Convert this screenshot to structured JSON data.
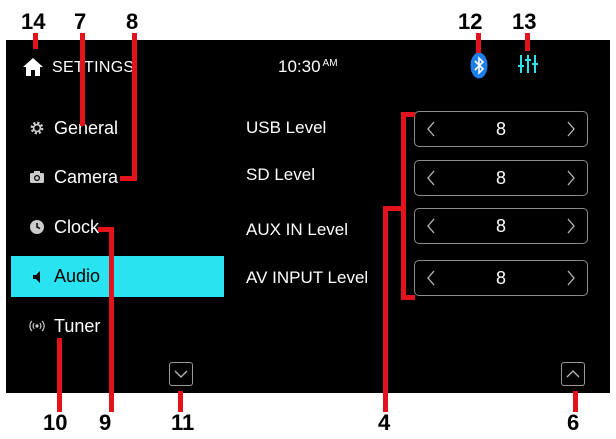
{
  "callouts": [
    "14",
    "7",
    "8",
    "12",
    "13",
    "10",
    "9",
    "11",
    "4",
    "6"
  ],
  "statusbar": {
    "title": "SETTINGS",
    "time": "10:30",
    "ampm": "AM",
    "home_icon": "home-icon",
    "bluetooth_icon": "bluetooth-icon",
    "eq_icon": "equalizer-icon",
    "accent_color": "#2ae3f0"
  },
  "sidebar": {
    "items": [
      {
        "label": "General",
        "icon": "gear-icon"
      },
      {
        "label": "Camera",
        "icon": "camera-icon"
      },
      {
        "label": "Clock",
        "icon": "clock-icon"
      },
      {
        "label": "Audio",
        "icon": "speaker-icon",
        "active": true
      },
      {
        "label": "Tuner",
        "icon": "antenna-icon"
      }
    ]
  },
  "levels": [
    {
      "label": "USB Level",
      "value": "8"
    },
    {
      "label": "SD Level",
      "value": "8"
    },
    {
      "label": "AUX IN Level",
      "value": "8"
    },
    {
      "label": "AV INPUT Level",
      "value": "8"
    }
  ],
  "annotation_color": "#e3131b"
}
